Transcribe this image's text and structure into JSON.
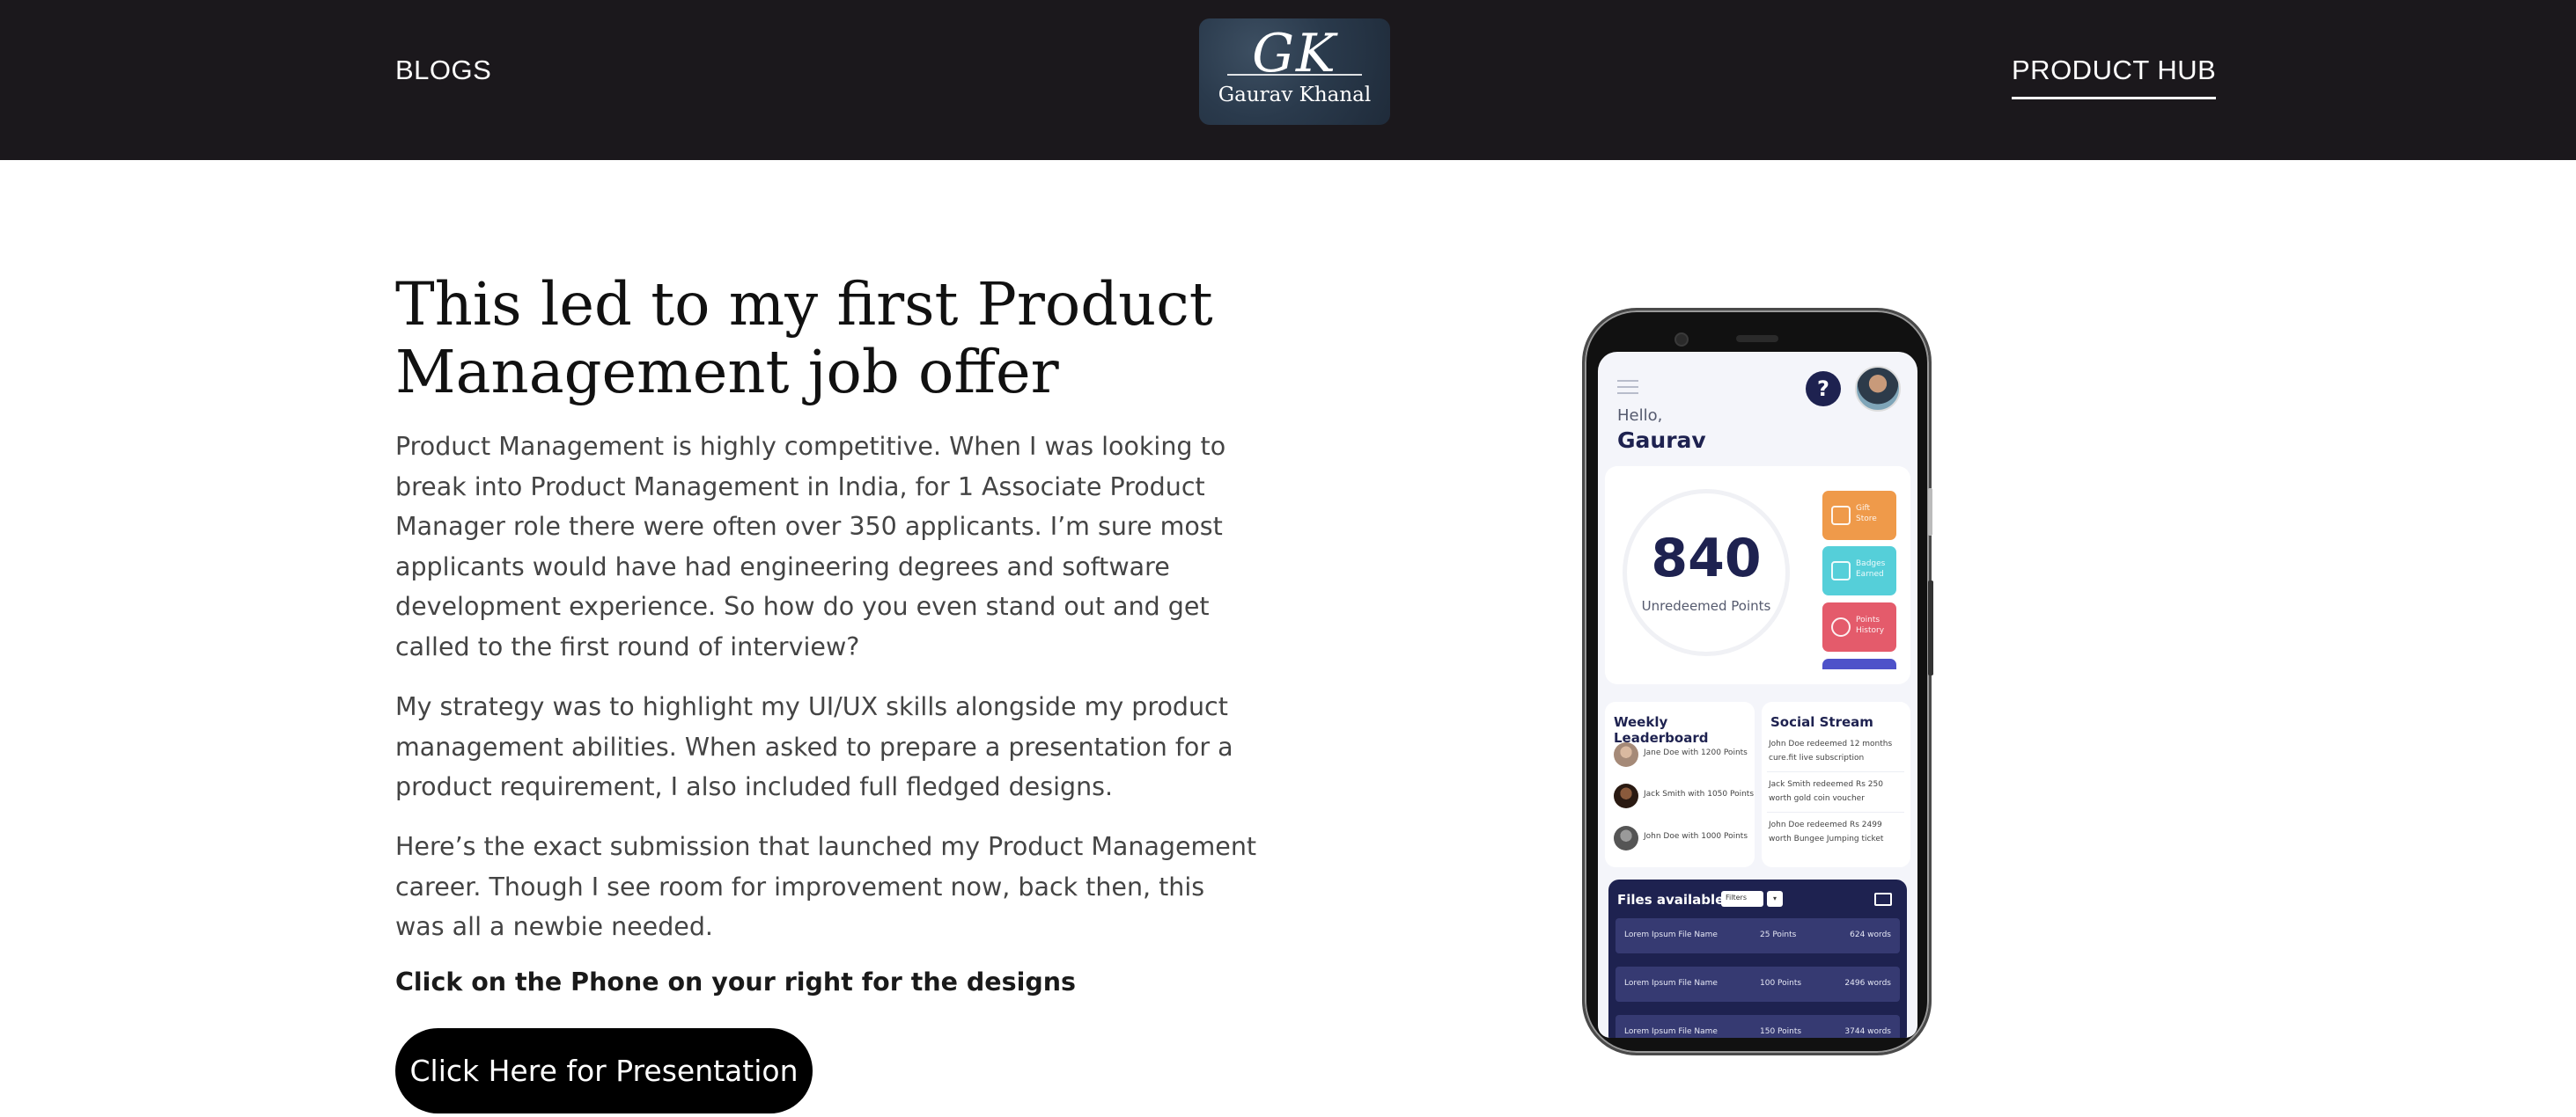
{
  "header": {
    "nav_left": "BLOGS",
    "nav_right": "PRODUCT HUB",
    "logo": {
      "initials": "GK",
      "name": "Gaurav Khanal"
    }
  },
  "main": {
    "title": "This led to my first Product Management job offer",
    "paragraphs": [
      "Product Management is highly competitive. When I was looking to break into Product Management in India, for 1 Associate Product Manager role there were often over 350 applicants. I’m sure most applicants would have had engineering degrees and software development experience. So how do you even stand out and get called to the first round of interview?",
      "My strategy was to highlight my UI/UX skills alongside my product management abilities. When asked to prepare a presentation for a product requirement, I also included full fledged designs.",
      "Here’s the exact submission that launched my Product Management career. Though I see room for improvement now, back then, this was all a newbie needed."
    ],
    "note": "Click on the Phone on your right for the designs",
    "button_label": "Click Here for Presentation"
  },
  "phone": {
    "greeting": "Hello,",
    "user_name": "Gaurav",
    "help_glyph": "?",
    "points": "840",
    "points_label": "Unredeemed Points",
    "tiles": [
      "Gift Store",
      "Badges Earned",
      "Points History"
    ],
    "tile_colors": [
      "#ef9a4a",
      "#55cfd9",
      "#e45b6b",
      "#4e52c9"
    ],
    "leaderboard": {
      "title": "Weekly Leaderboard",
      "rows": [
        "Jane Doe with 1200 Points",
        "Jack Smith with 1050 Points",
        "John Doe with 1000 Points"
      ]
    },
    "social_stream": {
      "title": "Social Stream",
      "items": [
        "John Doe redeemed 12 months cure.fit live subscription",
        "Jack Smith redeemed Rs 250 worth gold coin voucher",
        "John Doe redeemed Rs 2499 worth Bungee Jumping ticket"
      ]
    },
    "files": {
      "title": "Files available",
      "filter_value": "Filters",
      "rows": [
        {
          "name": "Lorem Ipsum File Name",
          "points": "25 Points",
          "words": "624 words"
        },
        {
          "name": "Lorem Ipsum File Name",
          "points": "100 Points",
          "words": "2496 words"
        },
        {
          "name": "Lorem Ipsum File Name",
          "points": "150 Points",
          "words": "3744 words"
        }
      ]
    }
  },
  "colors": {
    "header_bg": "#1b181c",
    "button_bg": "#000000",
    "app_navy": "#1e2250"
  }
}
